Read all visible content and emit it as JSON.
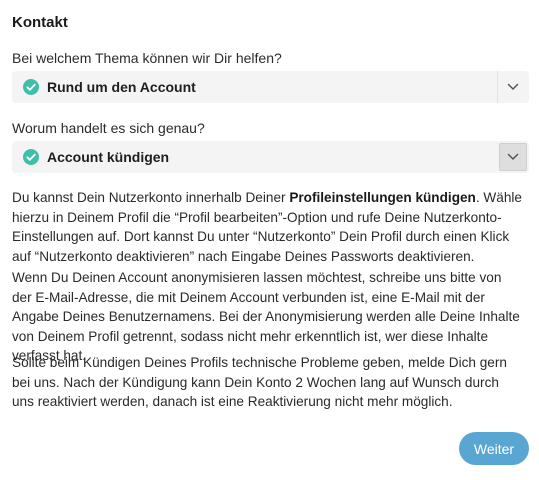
{
  "colors": {
    "check_badge": "#3fbfa9",
    "button_bg": "#5aa6d2",
    "select_bg": "#f4f4f4"
  },
  "page_title": "Kontakt",
  "topic": {
    "question": "Bei welchem Thema können wir Dir helfen?",
    "selected": "Rund um den Account",
    "check_icon": "check-circle-icon",
    "chevron_icon": "chevron-down-icon"
  },
  "subtopic": {
    "question": "Worum handelt es sich genau?",
    "selected": "Account kündigen",
    "check_icon": "check-circle-icon",
    "chevron_icon": "chevron-down-icon"
  },
  "paragraphs": {
    "p1_before": "Du kannst Dein Nutzerkonto innerhalb Deiner ",
    "p1_bold": "Profileinstellungen kündigen",
    "p1_after": ". Wähle hierzu in Deinem Profil die “Profil bearbeiten”-Option und rufe Deine Nutzerkonto-Einstellungen auf. Dort kannst Du unter “Nutzerkonto” Dein Profil durch einen Klick auf “Nutzerkonto deaktivieren” nach Eingabe Deines Passworts deaktivieren.",
    "p2": "Wenn Du Deinen Account anonymisieren lassen möchtest, schreibe uns bitte von der E-Mail-Adresse, die mit Deinem Account verbunden ist, eine E-Mail mit der Angabe Deines Benutzernamens. Bei der Anonymisierung werden alle Deine Inhalte von Deinem Profil getrennt, sodass nicht mehr erkenntlich ist, wer diese Inhalte verfasst hat.",
    "p3": "Sollte beim Kündigen Deines Profils technische Probleme geben, melde Dich gern bei uns. Nach der Kündigung kann Dein Konto 2 Wochen lang auf Wunsch durch uns reaktiviert werden, danach ist eine Reaktivierung nicht mehr möglich."
  },
  "next_button": "Weiter"
}
